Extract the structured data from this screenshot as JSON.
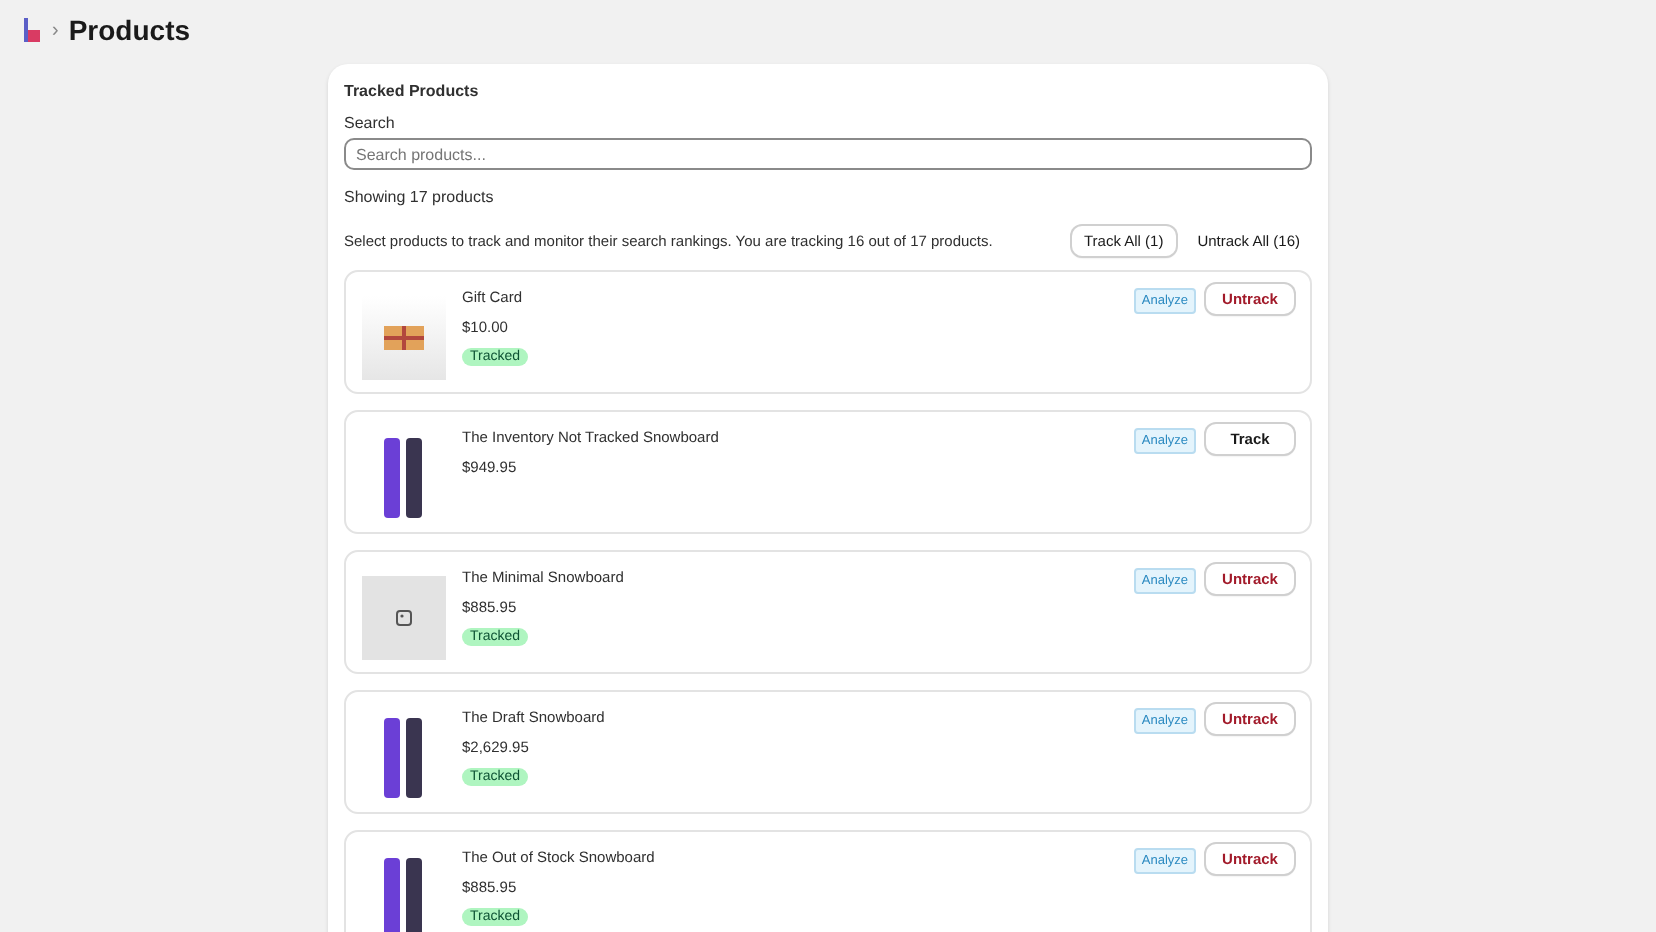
{
  "breadcrumb": {
    "separator": "›",
    "title": "Products"
  },
  "card": {
    "title": "Tracked Products",
    "search_label": "Search",
    "search_placeholder": "Search products...",
    "count": "Showing 17 products",
    "description": "Select products to track and monitor their search rankings. You are tracking 16 out of 17 products.",
    "track_all": "Track All (1)",
    "untrack_all": "Untrack All (16)"
  },
  "products": [
    {
      "name": "Gift Card",
      "price": "$10.00",
      "tracked": true,
      "badge": "Tracked",
      "kind": "gift",
      "analyze": "Analyze",
      "action": "Untrack"
    },
    {
      "name": "The Inventory Not Tracked Snowboard",
      "price": "$949.95",
      "tracked": false,
      "kind": "board",
      "analyze": "Analyze",
      "action": "Track"
    },
    {
      "name": "The Minimal Snowboard",
      "price": "$885.95",
      "tracked": true,
      "badge": "Tracked",
      "kind": "none",
      "analyze": "Analyze",
      "action": "Untrack"
    },
    {
      "name": "The Draft Snowboard",
      "price": "$2,629.95",
      "tracked": true,
      "badge": "Tracked",
      "kind": "board",
      "analyze": "Analyze",
      "action": "Untrack"
    },
    {
      "name": "The Out of Stock Snowboard",
      "price": "$885.95",
      "tracked": true,
      "badge": "Tracked",
      "kind": "board",
      "analyze": "Analyze",
      "action": "Untrack"
    }
  ]
}
